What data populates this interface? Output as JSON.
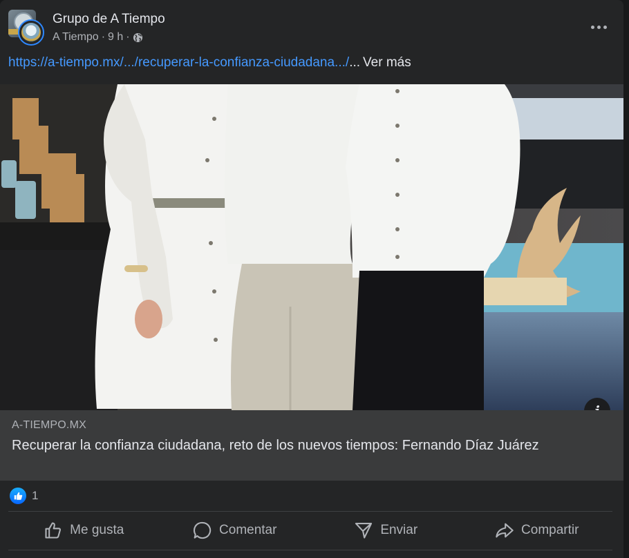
{
  "header": {
    "group_name": "Grupo de A Tiempo",
    "author": "A Tiempo",
    "separator": "·",
    "time": "9 h",
    "privacy_icon": "globe-icon"
  },
  "post": {
    "link_text": "https://a-tiempo.mx/.../recuperar-la-confianza-ciudadana.../",
    "ellipsis": "...",
    "see_more": "Ver más"
  },
  "preview": {
    "domain": "A-TIEMPO.MX",
    "title": "Recuperar la confianza ciudadana, reto de los nuevos tiempos: Fernando Díaz Juárez",
    "info_icon": "i"
  },
  "reactions": {
    "icon": "like-icon",
    "count": "1"
  },
  "actions": [
    {
      "label": "Me gusta",
      "icon": "thumbs-up-icon"
    },
    {
      "label": "Comentar",
      "icon": "comment-icon"
    },
    {
      "label": "Enviar",
      "icon": "send-icon"
    },
    {
      "label": "Compartir",
      "icon": "share-icon"
    }
  ],
  "colors": {
    "background": "#242526",
    "link": "#4599ff",
    "preview_bg": "#3a3b3c",
    "like_blue": "#0866ff"
  }
}
